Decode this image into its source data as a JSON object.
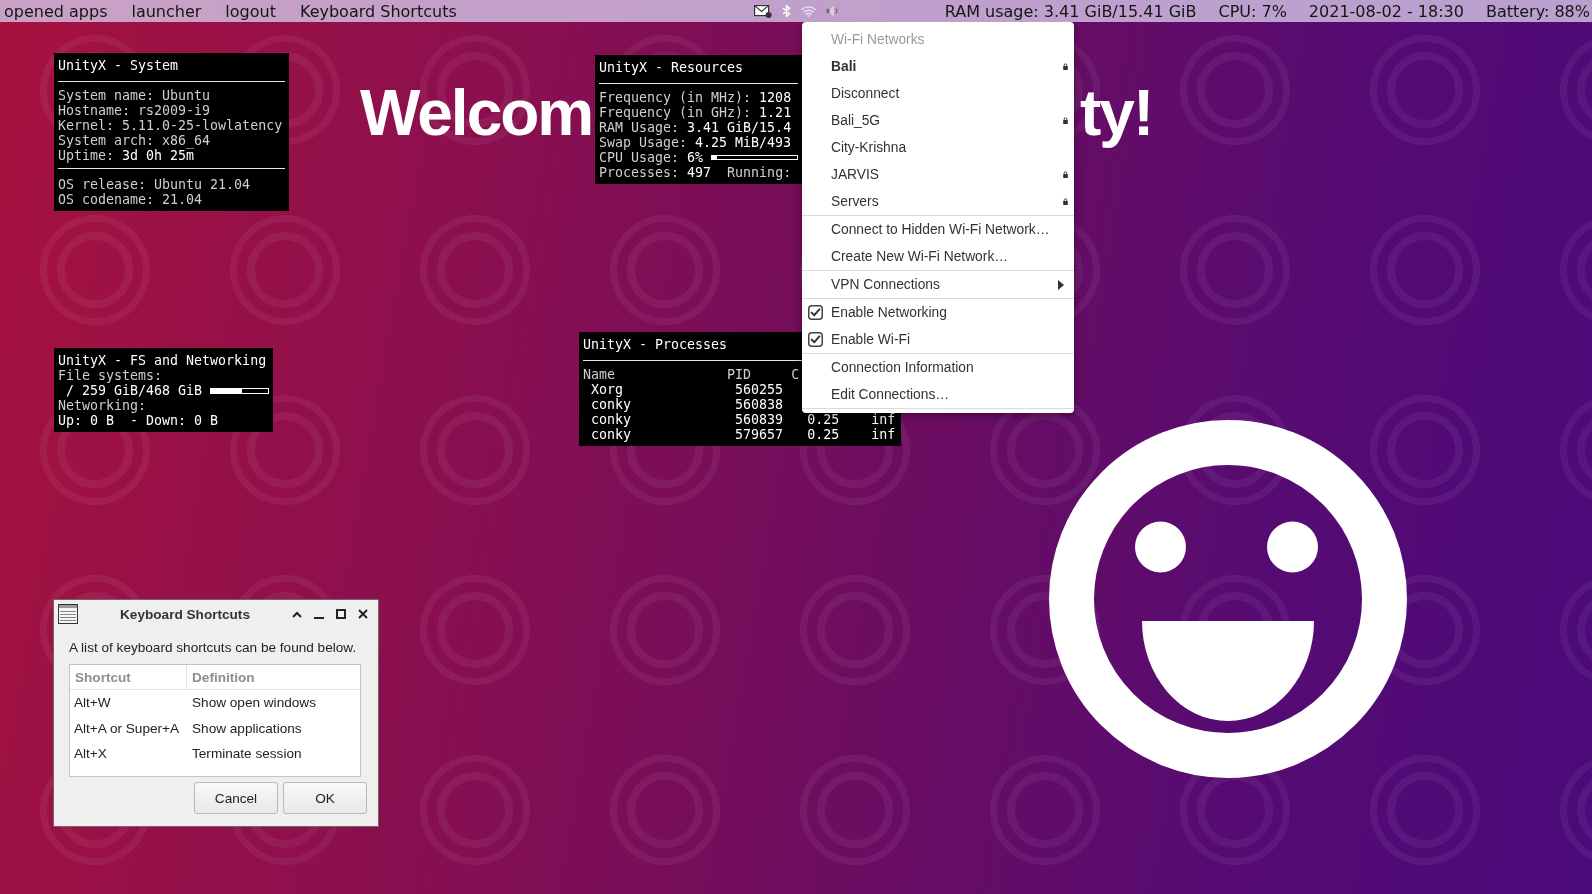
{
  "top_bar": {
    "menu_items": [
      "opened apps",
      "launcher",
      "logout",
      "Keyboard Shortcuts"
    ],
    "status_items": [
      "RAM usage: 3.41 GiB/15.41 GiB",
      "CPU: 7%",
      "2021-08-02 - 18:30",
      "Battery: 88%"
    ]
  },
  "wallpaper_text": [
    "Welcom",
    "ty!"
  ],
  "conky_system": {
    "title": "UnityX - System",
    "title_rule": true,
    "groups": [
      [
        {
          "parts": [
            {
              "kind": "text",
              "text": "System name: Ubuntu"
            }
          ]
        },
        {
          "parts": [
            {
              "kind": "text",
              "text": "Hostname: rs2009-i9"
            }
          ]
        },
        {
          "parts": [
            {
              "kind": "text",
              "text": "Kernel: 5.11.0-25-lowlatency"
            }
          ]
        },
        {
          "parts": [
            {
              "kind": "text",
              "text": "System arch: x86_64"
            }
          ]
        },
        {
          "parts": [
            {
              "kind": "label",
              "text": "Uptime:"
            },
            {
              "kind": "value",
              "text": "3d 0h 25m"
            }
          ]
        }
      ],
      [
        {
          "parts": [
            {
              "kind": "text",
              "text": "OS release: Ubuntu 21.04"
            }
          ]
        },
        {
          "parts": [
            {
              "kind": "text",
              "text": "OS codename: 21.04"
            }
          ]
        }
      ]
    ]
  },
  "conky_resources": {
    "title": "UnityX - Resources",
    "title_rule": true,
    "groups": [
      [
        {
          "parts": [
            {
              "kind": "label",
              "text": "Frequency (in MHz):"
            },
            {
              "kind": "value",
              "text": "1208"
            }
          ]
        },
        {
          "parts": [
            {
              "kind": "label",
              "text": "Frequency (in GHz):"
            },
            {
              "kind": "value",
              "text": "1.21"
            }
          ]
        },
        {
          "parts": [
            {
              "kind": "label",
              "text": "RAM Usage:"
            },
            {
              "kind": "value",
              "text": "3.41 GiB/15.4"
            }
          ]
        },
        {
          "parts": [
            {
              "kind": "label",
              "text": "Swap Usage:"
            },
            {
              "kind": "value",
              "text": "4.25 MiB/493"
            }
          ]
        },
        {
          "parts": [
            {
              "kind": "label",
              "text": "CPU Usage:"
            },
            {
              "kind": "value",
              "text": "6%"
            },
            {
              "kind": "bar",
              "level": 0.06
            }
          ]
        },
        {
          "parts": [
            {
              "kind": "label",
              "text": "Processes:"
            },
            {
              "kind": "value",
              "text": "497"
            },
            {
              "kind": "label",
              "text": "Running:"
            }
          ]
        }
      ]
    ]
  },
  "conky_fs_networking": {
    "title": "UnityX - FS and Networking",
    "title_rule": false,
    "groups": [
      [
        {
          "parts": [
            {
              "kind": "label",
              "text": "File systems:"
            }
          ]
        },
        {
          "parts": [
            {
              "kind": "value",
              "text": " / 259 GiB/468 GiB"
            },
            {
              "kind": "bar",
              "level": 0.55
            }
          ]
        },
        {
          "parts": [
            {
              "kind": "label",
              "text": "Networking:"
            }
          ]
        },
        {
          "parts": [
            {
              "kind": "value",
              "text": "Up: 0 B  - Down: 0 B"
            }
          ]
        }
      ]
    ]
  },
  "conky_processes": {
    "title": "UnityX - Processes",
    "columns": [
      "Name",
      "PID",
      "C"
    ],
    "rows": [
      [
        "Xorg",
        "560255"
      ],
      [
        "conky",
        "560838"
      ],
      [
        "conky",
        "560839",
        "0.25",
        "inf"
      ],
      [
        "conky",
        "579657",
        "0.25",
        "inf"
      ]
    ]
  },
  "wifi_menu": {
    "sections": [
      {
        "items": [
          {
            "kind": "header",
            "label": "Wi-Fi Networks"
          },
          {
            "kind": "network",
            "label": "Bali",
            "selected": true,
            "secured": true
          },
          {
            "kind": "action",
            "label": "Disconnect"
          },
          {
            "kind": "network",
            "label": "Bali_5G",
            "selected": false,
            "secured": true
          },
          {
            "kind": "network",
            "label": "City-Krishna",
            "selected": false,
            "secured": false
          },
          {
            "kind": "network",
            "label": "JARVIS",
            "selected": false,
            "secured": true
          },
          {
            "kind": "network",
            "label": "Servers",
            "selected": false,
            "secured": true
          }
        ]
      },
      {
        "items": [
          {
            "kind": "action",
            "label": "Connect to Hidden Wi-Fi Network…"
          },
          {
            "kind": "action",
            "label": "Create New Wi-Fi Network…"
          }
        ]
      },
      {
        "items": [
          {
            "kind": "submenu",
            "label": "VPN Connections"
          }
        ]
      },
      {
        "items": [
          {
            "kind": "check",
            "label": "Enable Networking",
            "checked": true
          },
          {
            "kind": "check",
            "label": "Enable Wi-Fi",
            "checked": true
          }
        ]
      },
      {
        "items": [
          {
            "kind": "action",
            "label": "Connection Information"
          },
          {
            "kind": "action",
            "label": "Edit Connections…"
          }
        ]
      }
    ]
  },
  "keyboard_shortcuts_dialog": {
    "title": "Keyboard Shortcuts",
    "message": "A list of keyboard shortcuts can be found below.",
    "table": {
      "columns": [
        "Shortcut",
        "Definition"
      ],
      "rows": [
        [
          "Alt+W",
          "Show open windows"
        ],
        [
          "Alt+A or Super+A",
          "Show applications"
        ],
        [
          "Alt+X",
          "Terminate session"
        ]
      ]
    },
    "buttons": [
      "Cancel",
      "OK"
    ]
  }
}
